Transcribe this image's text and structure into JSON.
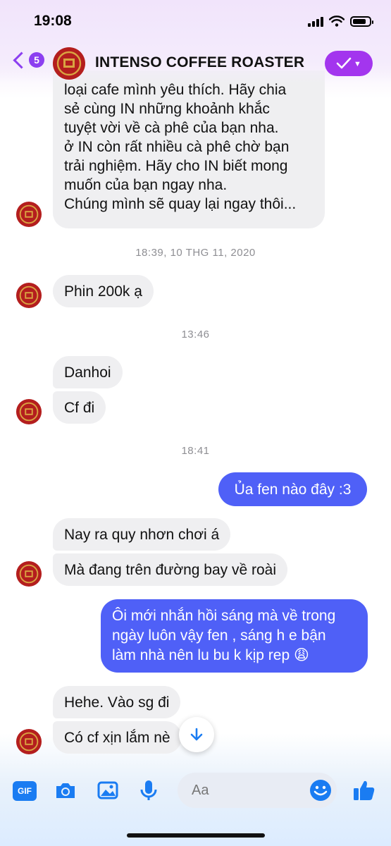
{
  "status_bar": {
    "time": "19:08",
    "battery_level": 0.8,
    "signal_bars": 4
  },
  "header": {
    "back_count": "5",
    "title": "INTENSO COFFEE ROASTER",
    "action_icon": "check-icon"
  },
  "messages": [
    {
      "type": "incoming",
      "text": "loại cafe mình yêu thích. Hãy chia\nsẻ cùng IN những khoảnh khắc\ntuyệt vời về cà phê của bạn nha.\nở IN còn rất nhiều cà phê chờ bạn\ntrải nghiệm. Hãy cho IN biết mong\nmuốn của bạn ngay nha.\nChúng mình sẽ quay lại ngay thôi..."
    },
    {
      "type": "timestamp",
      "text": "18:39, 10 THG 11, 2020"
    },
    {
      "type": "incoming",
      "text": "Phin 200k ạ"
    },
    {
      "type": "timestamp",
      "text": "13:46"
    },
    {
      "type": "incoming",
      "text": "Danhoi"
    },
    {
      "type": "incoming",
      "text": "Cf đi"
    },
    {
      "type": "timestamp",
      "text": "18:41"
    },
    {
      "type": "outgoing",
      "text": "Ủa fen nào đây :3"
    },
    {
      "type": "incoming",
      "text": "Nay ra quy nhơn chơi á"
    },
    {
      "type": "incoming",
      "text": "Mà đang trên đường bay về roài"
    },
    {
      "type": "outgoing",
      "line1": "Ôi mới nhắn hồi sáng mà về trong",
      "line2": "ngày luôn vậy fen , sáng h e bận",
      "line3": "làm nhà nên lu bu k kịp rep",
      "emoji": "😩"
    },
    {
      "type": "incoming",
      "text": "Hehe. Vào sg đi"
    },
    {
      "type": "incoming",
      "text": "Có cf xịn lắm nè"
    }
  ],
  "composer": {
    "gif_label": "GIF",
    "placeholder": "Aa",
    "tools": [
      "gif-icon",
      "camera-icon",
      "image-icon",
      "microphone-icon",
      "emoji-icon",
      "like-icon"
    ]
  },
  "colors": {
    "accent_purple": "#8c3ff0",
    "outgoing_bubble": "#4f60f7",
    "incoming_bubble": "#efeff1",
    "messenger_blue": "#1a7cf2",
    "avatar_red": "#b41e1e",
    "avatar_gold": "#d9a441"
  }
}
